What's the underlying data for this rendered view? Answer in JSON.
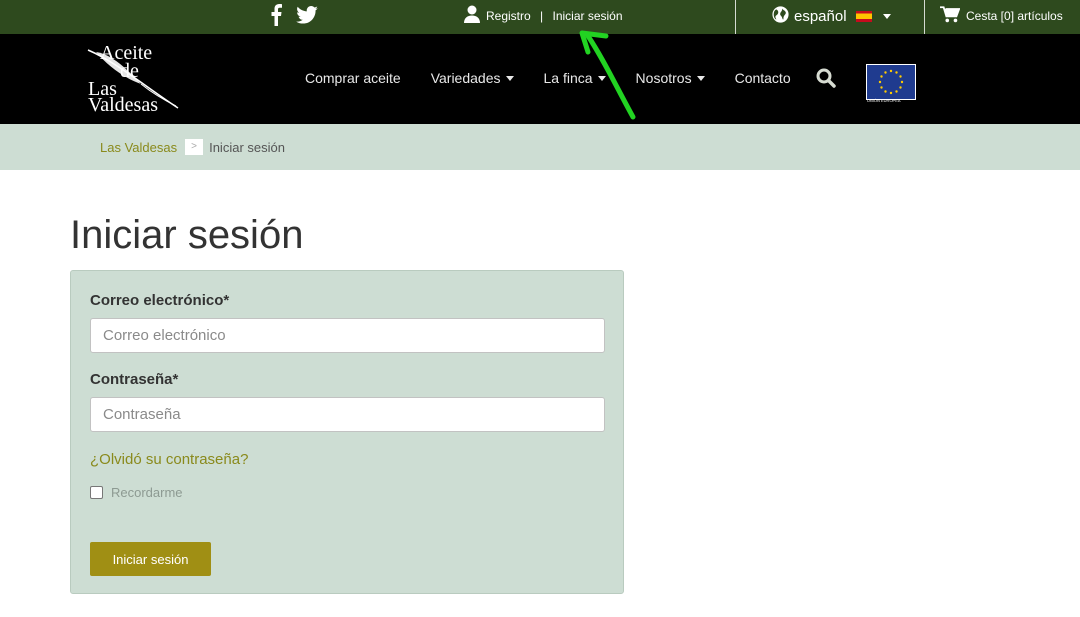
{
  "topbar": {
    "social": [
      {
        "icon": "facebook-icon"
      },
      {
        "icon": "twitter-icon"
      }
    ],
    "account": {
      "icon": "user-icon",
      "register_label": "Registro",
      "separator": " | ",
      "login_label": "Iniciar sesión"
    },
    "language": {
      "icon": "globe-icon",
      "label": "español",
      "flag": "spain-flag-icon"
    },
    "cart": {
      "icon": "shopping-cart-icon",
      "label": "Cesta [0] artículos"
    }
  },
  "navbar": {
    "logo": {
      "line1": "Aceite",
      "line2": "de",
      "line3": "Las",
      "line4": "Valdesas"
    },
    "menu": [
      {
        "label": "Comprar aceite",
        "dropdown": false
      },
      {
        "label": "Variedades",
        "dropdown": true
      },
      {
        "label": "La finca",
        "dropdown": true
      },
      {
        "label": "Nosotros",
        "dropdown": true
      },
      {
        "label": "Contacto",
        "dropdown": false
      }
    ],
    "search_icon": "search-icon",
    "eu_label": "UNIÓN EUROPEA"
  },
  "breadcrumb": {
    "home": "Las Valdesas",
    "separator": ">",
    "current": "Iniciar sesión"
  },
  "page": {
    "title": "Iniciar sesión"
  },
  "form": {
    "email_label": "Correo electrónico*",
    "email_placeholder": "Correo electrónico",
    "email_value": "",
    "password_label": "Contraseña*",
    "password_placeholder": "Contraseña",
    "password_value": "",
    "forgot_label": "¿Olvidó su contraseña?",
    "remember_label": "Recordarme",
    "submit_label": "Iniciar sesión"
  },
  "colors": {
    "topbar_bg": "#2e4a1e",
    "navbar_bg": "#000000",
    "panel_bg": "#cdddd3",
    "accent_olive": "#8a8a1c",
    "button_bg": "#a08f14",
    "annotation_arrow": "#22d322"
  }
}
